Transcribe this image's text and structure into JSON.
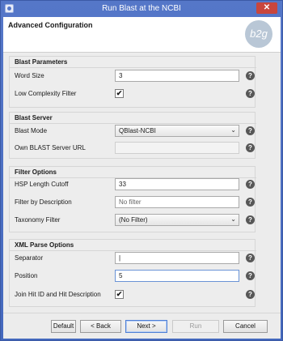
{
  "window": {
    "title": "Run Blast at the NCBI",
    "close_label": "✕"
  },
  "header": {
    "title": "Advanced Configuration",
    "logo_text": "b2g"
  },
  "groups": {
    "blast_params": {
      "title": "Blast Parameters",
      "word_size": {
        "label": "Word Size",
        "value": "3"
      },
      "low_complexity": {
        "label": "Low Complexity Filter",
        "checked": "✔"
      }
    },
    "blast_server": {
      "title": "Blast Server",
      "mode": {
        "label": "Blast Mode",
        "value": "QBlast-NCBI"
      },
      "own_url": {
        "label": "Own BLAST Server URL",
        "value": ""
      }
    },
    "filter": {
      "title": "Filter Options",
      "hsp": {
        "label": "HSP Length Cutoff",
        "value": "33"
      },
      "desc": {
        "label": "Filter by Description",
        "placeholder": "No filter"
      },
      "taxonomy": {
        "label": "Taxonomy Filter",
        "value": "(No Filter)"
      }
    },
    "xml": {
      "title": "XML Parse Options",
      "separator": {
        "label": "Separator",
        "value": "|"
      },
      "position": {
        "label": "Position",
        "value": "5"
      },
      "join": {
        "label": "Join Hit ID and Hit Description",
        "checked": "✔"
      }
    }
  },
  "help_label": "?",
  "select_chevron": "⌄",
  "footer": {
    "default": "Default",
    "back": "< Back",
    "next": "Next >",
    "run": "Run",
    "cancel": "Cancel"
  }
}
